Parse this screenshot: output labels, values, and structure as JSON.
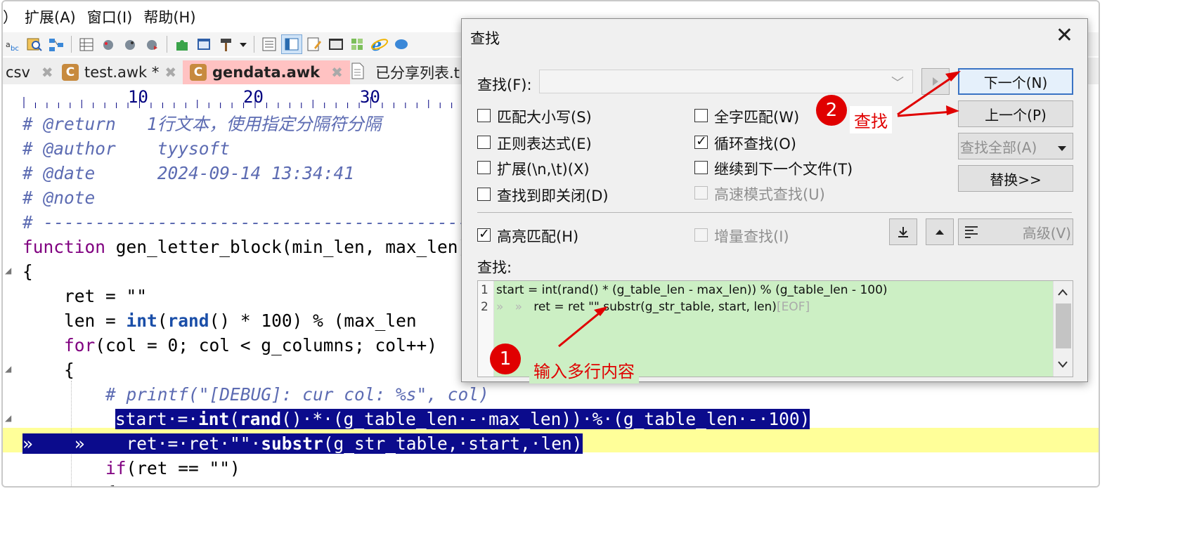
{
  "menu": [
    "）",
    "扩展(A)",
    "窗口(I)",
    "帮助(H)"
  ],
  "toolbar_icons": [
    "abc-icon",
    "find-file-icon",
    "tree-icon",
    "grid-icon",
    "bug-icon",
    "bug-step-icon",
    "bug-run-icon",
    "puzzle-icon",
    "window-icon",
    "hammer-icon",
    "dropdown-arrow-icon",
    "list-icon",
    "panel-icon",
    "edit-icon",
    "console-icon",
    "grid-green-icon",
    "ie-icon",
    "chat-icon"
  ],
  "tabs": [
    {
      "label": "csv",
      "icon": "",
      "close": "✖"
    },
    {
      "label": "test.awk *",
      "icon": "C",
      "close": "✖"
    },
    {
      "label": "gendata.awk",
      "icon": "C",
      "close": "✖"
    },
    {
      "label": "已分享列表.t",
      "icon": "doc",
      "close": ""
    }
  ],
  "ruler": [
    "10",
    "20",
    "30"
  ],
  "code": {
    "l1_a": "# @return   1行文本，使用指定分隔符分隔",
    "l2": "# @author    tyysoft",
    "l3": "# @date      2024-09-14 13:34:41",
    "l4": "# @note",
    "l5": "# -----------------------------------------",
    "l6_kw": "function",
    "l6_rest": " gen_letter_block(min_len, max_len)",
    "l7": "{",
    "l8": "    ret = \"\"",
    "l9_a": "    len = ",
    "l9_int": "int",
    "l9_b": "(",
    "l9_rand": "rand",
    "l9_c": "() * 100) % (max_len",
    "l10_a": "    ",
    "l10_for": "for",
    "l10_b": "(col = 0; col < g_columns; col++)",
    "l11": "    {",
    "l12": "        # printf(\"[DEBUG]: cur col: %s\", col)",
    "l13_a": "start·=·",
    "l13_int": "int",
    "l13_b": "(",
    "l13_rand": "rand",
    "l13_c": "()·*·(g_table_len·-·max_len))·%·(g_table_len·-·100)",
    "l14_tabs": "»    »    ",
    "l14_a": "ret·=·ret·\"\"·",
    "l14_substr": "substr",
    "l14_b": "(g_str_table,·start,·len)",
    "l15_a": "        ",
    "l15_if": "if",
    "l15_b": "(ret == \"\")",
    "l16": "        {"
  },
  "dialog": {
    "title": "查找",
    "close": "✕",
    "find_label": "查找(F):",
    "find_value": "",
    "combo_chevron": "﹀",
    "options": {
      "match_case": "匹配大小写(S)",
      "whole_word": "全字匹配(W)",
      "regex": "正则表达式(E)",
      "wrap": "循环查找(O)",
      "extended": "扩展(\\n,\\t)(X)",
      "next_file": "继续到下一个文件(T)",
      "close_on_find": "查找到即关闭(D)",
      "fast_mode": "高速模式查找(U)",
      "highlight": "高亮匹配(H)",
      "incremental": "增量查找(I)"
    },
    "buttons": {
      "next": "下一个(N)",
      "prev": "上一个(P)",
      "find_all": "查找全部(A)",
      "replace": "替换>>",
      "advanced": "高级(V)"
    },
    "multiline_label": "查找:",
    "multiline": {
      "ln1": "1",
      "ln2": "2",
      "line1": "start = int(rand() * (g_table_len - max_len)) % (g_table_len - 100)",
      "line2_tabs": "»   »   ",
      "line2": "ret = ret \"\" substr(g_str_table, start, len)",
      "eof": "[EOF]"
    }
  },
  "annotations": {
    "badge1": "1",
    "note1": "输入多行内容",
    "badge2": "2",
    "note2": "查找"
  },
  "colors": {
    "selection": "#0b0b8c",
    "current_line": "#ffff99",
    "active_tab": "#ffc2c2",
    "multiline_bg": "#ccefc4",
    "annotation_red": "#e00000"
  }
}
